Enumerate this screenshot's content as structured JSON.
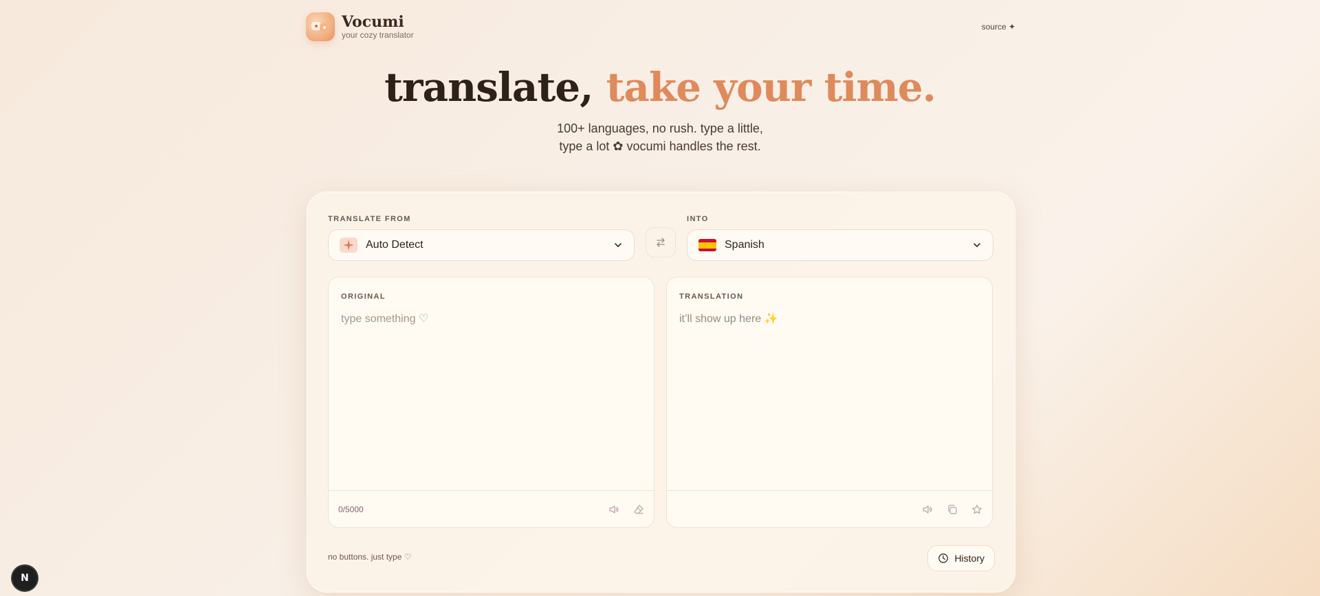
{
  "header": {
    "app_name": "Vocumi",
    "tagline": "your cozy translator",
    "source_link": "source ✦"
  },
  "hero": {
    "title_main": "translate,",
    "title_accent": "take your time.",
    "subtitle_line1": "100+ languages, no rush. type a little,",
    "subtitle_line2": "type a lot ✿ vocumi handles the rest."
  },
  "selectors": {
    "from_label": "TRANSLATE FROM",
    "from_value": "Auto Detect",
    "into_label": "INTO",
    "into_value": "Spanish"
  },
  "original": {
    "label": "ORIGINAL",
    "placeholder": "type something ♡",
    "counter": "0/5000"
  },
  "translation": {
    "label": "TRANSLATION",
    "placeholder": "it’ll show up here ✨"
  },
  "footer": {
    "note": "no buttons. just type ♡",
    "history_label": "History"
  },
  "badge": {
    "letter": "N"
  },
  "colors": {
    "accent": "#df8a5c",
    "text_dark": "#2e2119",
    "card_bg": "#fcf3e8"
  }
}
